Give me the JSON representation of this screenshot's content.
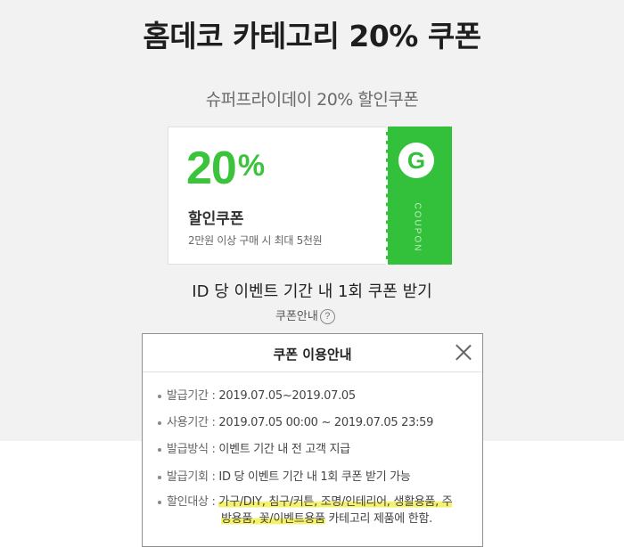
{
  "page": {
    "title": "홈데코 카테고리 20% 쿠폰",
    "subtitle": "슈퍼프라이데이 20% 할인쿠폰"
  },
  "coupon": {
    "value": "20",
    "unit": "%",
    "name": "할인쿠폰",
    "condition": "2만원 이상 구매 시 최대 5천원",
    "stub_letter": "G",
    "stub_label": "COUPON",
    "color": "#33c13c"
  },
  "event_note": "ID 당 이벤트 기간 내 1회 쿠폰 받기",
  "guide_link": {
    "label": "쿠폰안내",
    "icon_text": "?"
  },
  "popup": {
    "title": "쿠폰 이용안내",
    "rows": [
      {
        "label": "발급기간 :",
        "value": "2019.07.05~2019.07.05"
      },
      {
        "label": "사용기간 :",
        "value": "2019.07.05 00:00 ~ 2019.07.05 23:59"
      },
      {
        "label": "발급방식 :",
        "value": "이벤트 기간 내 전 고객 지급"
      },
      {
        "label": "발급기회 :",
        "value": "ID 당 이벤트 기간 내 1회 쿠폰 받기 가능"
      },
      {
        "label": "할인대상 :",
        "value_line1": "가구/DIY, 침구/커튼, 조명/인테리어, 생활용품, 주",
        "value_line2_hl": "방용품, 꽃/이벤트용품",
        "value_line2_rest": " 카테고리 제품에 한함."
      }
    ]
  },
  "colors": {
    "highlight": "#f4f26b",
    "background_top": "#f2f2f2"
  }
}
